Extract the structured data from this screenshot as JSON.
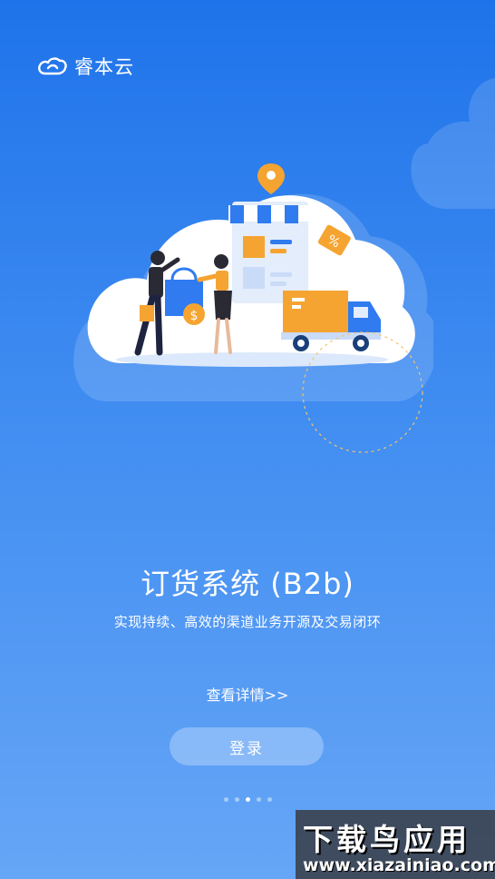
{
  "brand": {
    "name": "睿本云",
    "icon": "cloud-logo-icon"
  },
  "hero": {
    "title": "订货系统 (B2b)",
    "subtitle": "实现持续、高效的渠道业务开源及交易闭环"
  },
  "actions": {
    "details_link": "查看详情>>",
    "login_label": "登录"
  },
  "pager": {
    "count": 5,
    "active_index": 2
  },
  "watermark": {
    "line1": "下载鸟应用",
    "line2": "www.xiazainiao.com"
  },
  "colors": {
    "bg_top": "#1f73ea",
    "bg_bottom": "#66a6f6",
    "accent_orange": "#f5a431",
    "awning_blue": "#2f7bef"
  }
}
